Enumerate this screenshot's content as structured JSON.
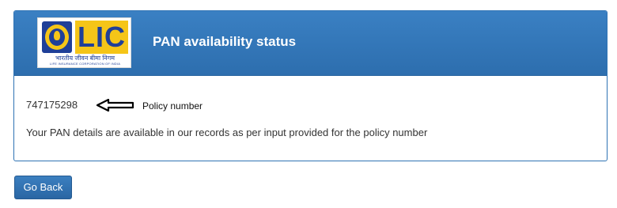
{
  "header": {
    "title": "PAN availability status"
  },
  "logo": {
    "wordmark": "LIC",
    "hindi_text": "भारतीय जीवन बीमा निगम",
    "english_text": "LIFE INSURANCE CORPORATION OF INDIA"
  },
  "policy": {
    "number": "747175298",
    "label": "Policy number",
    "arrow_icon": "left-arrow-icon"
  },
  "message": "Your PAN details are available in our records as per input provided for the policy number",
  "actions": {
    "go_back_label": "Go Back"
  },
  "colors": {
    "header_blue": "#2f73b4",
    "button_blue": "#2a66a3",
    "logo_yellow": "#f5c518",
    "logo_blue": "#1f3f98"
  }
}
